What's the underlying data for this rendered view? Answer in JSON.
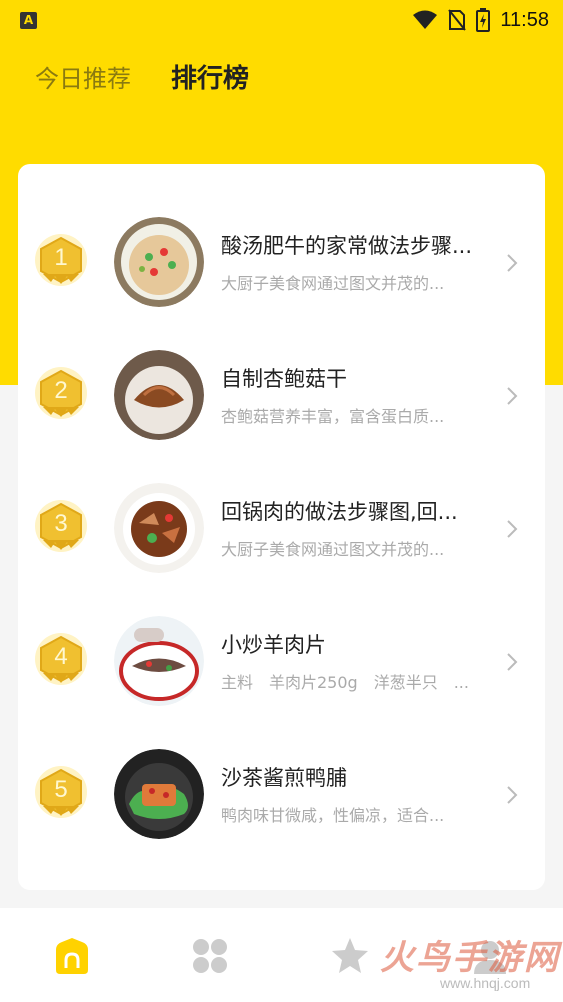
{
  "status_bar": {
    "app_badge": "A",
    "time": "11:58"
  },
  "tabs": [
    {
      "label": "今日推荐",
      "active": false
    },
    {
      "label": "排行榜",
      "active": true
    }
  ],
  "ranking": [
    {
      "rank": "1",
      "title": "酸汤肥牛的家常做法步骤...",
      "desc": "大厨子美食网通过图文并茂的..."
    },
    {
      "rank": "2",
      "title": "自制杏鲍菇干",
      "desc": "杏鲍菇营养丰富，富含蛋白质..."
    },
    {
      "rank": "3",
      "title": "回锅肉的做法步骤图,回...",
      "desc": "大厨子美食网通过图文并茂的..."
    },
    {
      "rank": "4",
      "title": "小炒羊肉片",
      "desc": "主料　羊肉片250g　洋葱半只　..."
    },
    {
      "rank": "5",
      "title": "沙茶酱煎鸭脯",
      "desc": "鸭肉味甘微咸，性偏凉，适合..."
    }
  ],
  "bottom_nav": {
    "items": [
      "home-icon",
      "category-icon",
      "favorite-icon",
      "profile-icon"
    ]
  },
  "watermark": {
    "text": "火鸟手游网",
    "url": "www.hnqj.com"
  },
  "colors": {
    "brand_yellow": "#ffdc00",
    "medal_gold": "#f0c030"
  }
}
